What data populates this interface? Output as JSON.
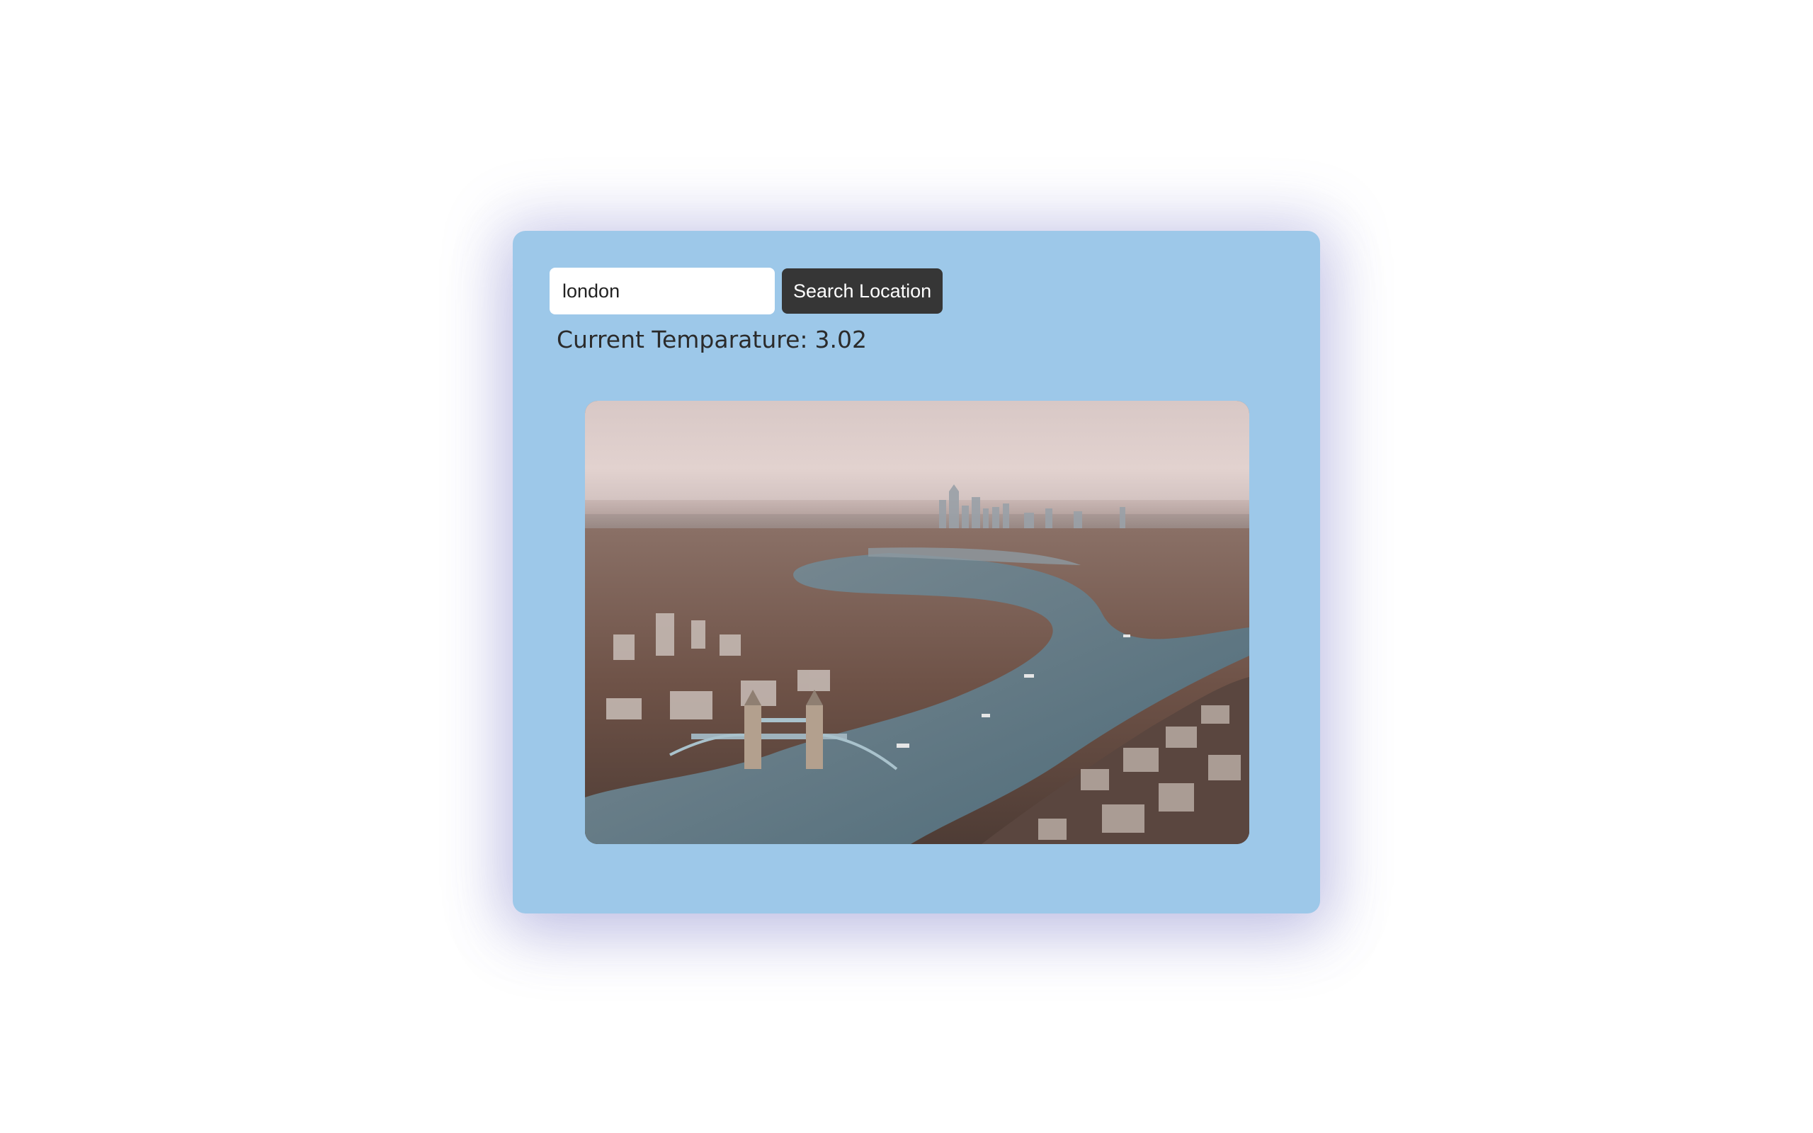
{
  "search": {
    "value": "london",
    "placeholder": "",
    "button_label": "Search Location"
  },
  "weather": {
    "temperature_label": "Current Temparature:",
    "temperature_value": "3.02"
  },
  "colors": {
    "page_background": "#ffffff",
    "card_background": "#9dc8e9",
    "button_background": "#363636",
    "button_text": "#ffffff",
    "text": "#2b2b2b"
  },
  "image": {
    "subject": "aerial-photo-london-thames-tower-bridge"
  }
}
